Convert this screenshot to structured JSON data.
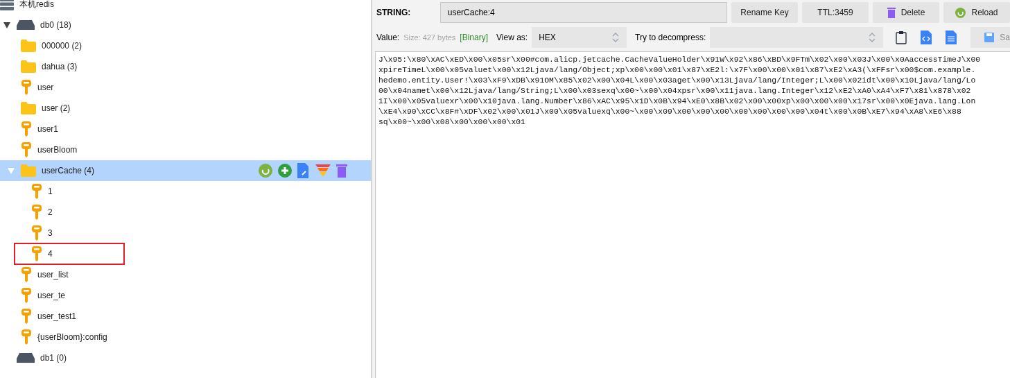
{
  "tree": [
    {
      "kind": "server",
      "label": "本机redis",
      "selected": false,
      "highlighted": false,
      "children": [
        {
          "kind": "db",
          "label": "db0  (18)",
          "expanded": true,
          "selected": false,
          "highlighted": false,
          "children": [
            {
              "kind": "folder",
              "label": "000000 (2)",
              "selected": false,
              "highlighted": false
            },
            {
              "kind": "folder",
              "label": "dahua (3)",
              "selected": false,
              "highlighted": false
            },
            {
              "kind": "key",
              "label": "user",
              "selected": false,
              "highlighted": false
            },
            {
              "kind": "folder",
              "label": "user (2)",
              "selected": false,
              "highlighted": false
            },
            {
              "kind": "key",
              "label": "user1",
              "selected": false,
              "highlighted": false
            },
            {
              "kind": "key",
              "label": "userBloom",
              "selected": false,
              "highlighted": false
            },
            {
              "kind": "folder",
              "label": "userCache (4)",
              "expanded": true,
              "selected": true,
              "highlighted": false,
              "children": [
                {
                  "kind": "key",
                  "label": "1",
                  "selected": false,
                  "highlighted": false
                },
                {
                  "kind": "key",
                  "label": "2",
                  "selected": false,
                  "highlighted": false
                },
                {
                  "kind": "key",
                  "label": "3",
                  "selected": false,
                  "highlighted": false
                },
                {
                  "kind": "key",
                  "label": "4",
                  "selected": false,
                  "highlighted": true
                }
              ]
            },
            {
              "kind": "key",
              "label": "user_list",
              "selected": false,
              "highlighted": false
            },
            {
              "kind": "key",
              "label": "user_te",
              "selected": false,
              "highlighted": false
            },
            {
              "kind": "key",
              "label": "user_test1",
              "selected": false,
              "highlighted": false
            },
            {
              "kind": "key",
              "label": "{userBloom}:config",
              "selected": false,
              "highlighted": false
            }
          ]
        },
        {
          "kind": "db",
          "label": "db1  (0)",
          "selected": false,
          "highlighted": false
        }
      ]
    }
  ],
  "key_bar": {
    "type_label": "STRING:",
    "key_name": "userCache:4",
    "buttons": [
      {
        "kind": "rename",
        "label": "Rename Key"
      },
      {
        "kind": "ttl",
        "label": "TTL:3459"
      },
      {
        "kind": "delete",
        "label": "Delete"
      },
      {
        "kind": "reload",
        "label": "Reload"
      }
    ]
  },
  "value_bar": {
    "label": "Value:",
    "size": "Size: 427 bytes",
    "format": "[Binary]",
    "view_as_label": "View as:",
    "view_as": "HEX",
    "decompress_label": "Try to decompress:",
    "save_label": "Sa",
    "save_disabled": true
  },
  "value_lines": [
    "J\\x95:\\x80\\xAC\\xED\\x00\\x05sr\\x00#com.alicp.jetcache.CacheValueHolder\\x91W\\x92\\x86\\xBD\\x9FTm\\x02\\x00\\x03J\\x00\\x0AaccessTimeJ\\x00",
    "xpireTimeL\\x00\\x05valuet\\x00\\x12Ljava/lang/Object;xp\\x00\\x00\\x01\\x87\\xE2l:\\x7F\\x00\\x00\\x01\\x87\\xE2\\xA3(\\xFFsr\\x00$com.example.",
    "hedemo.entity.User!\\x03\\xF9\\xDB\\x91OM\\x85\\x02\\x00\\x04L\\x00\\x03aget\\x00\\x13Ljava/lang/Integer;L\\x00\\x02idt\\x00\\x10Ljava/lang/Lo",
    "00\\x04namet\\x00\\x12Ljava/lang/String;L\\x00\\x03sexq\\x00~\\x00\\x04xpsr\\x00\\x11java.lang.Integer\\x12\\xE2\\xA0\\xA4\\xF7\\x81\\x878\\x02",
    "1I\\x00\\x05valuexr\\x00\\x10java.lang.Number\\x86\\xAC\\x95\\x1D\\x0B\\x94\\xE0\\x8B\\x02\\x00\\x00xp\\x00\\x00\\x00\\x17sr\\x00\\x0Ejava.lang.Lon",
    "\\xE4\\x90\\xCC\\x8F#\\xDF\\x02\\x00\\x01J\\x00\\x05valuexq\\x00~\\x00\\x09\\x00\\x00\\x00\\x00\\x00\\x00\\x00\\x04t\\x00\\x0B\\xE7\\x94\\xA8\\xE6\\x88",
    "sq\\x00~\\x00\\x08\\x00\\x00\\x00\\x01"
  ]
}
